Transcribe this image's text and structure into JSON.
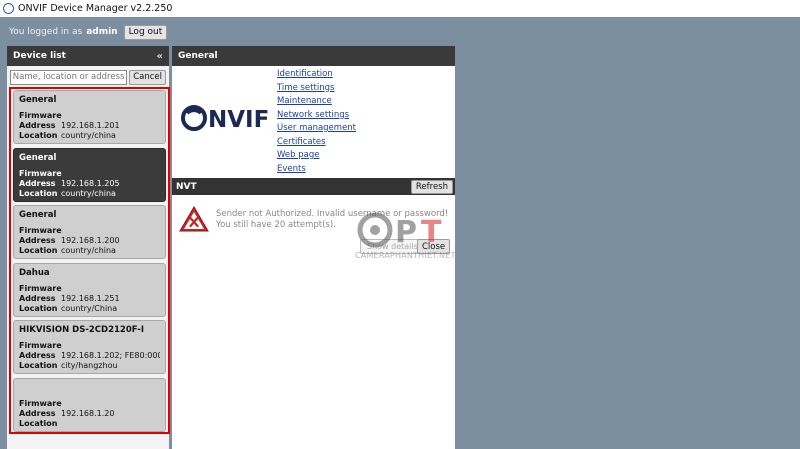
{
  "window": {
    "title": "ONVIF Device Manager v2.2.250"
  },
  "login": {
    "prefix": "You logged in as",
    "user": "admin",
    "logout_label": "Log out"
  },
  "device_list": {
    "title": "Device list",
    "search_placeholder": "Name, location or address",
    "cancel_label": "Cancel",
    "labels": {
      "firmware": "Firmware",
      "address": "Address",
      "location": "Location"
    },
    "devices": [
      {
        "name": "General",
        "address": "192.168.1.201",
        "location": "country/china"
      },
      {
        "name": "General",
        "address": "192.168.1.205",
        "location": "country/china"
      },
      {
        "name": "General",
        "address": "192.168.1.200",
        "location": "country/china"
      },
      {
        "name": "Dahua",
        "address": "192.168.1.251",
        "location": "country/China"
      },
      {
        "name": "HIKVISION DS-2CD2120F-I",
        "address": "192.168.1.202; FE80:0000:0000",
        "location": "city/hangzhou"
      },
      {
        "name": "",
        "address": "192.168.1.20",
        "location": ""
      }
    ]
  },
  "main": {
    "header": "General",
    "logo_text": "ONVIF",
    "links": [
      "Identification",
      "Time settings",
      "Maintenance",
      "Network settings",
      "User management",
      "Certificates",
      "Web page",
      "Events"
    ],
    "nvt_label": "NVT",
    "refresh_label": "Refresh",
    "alert_message": "Sender not Authorized. Invalid username or password! You still have 20 attempt(s).",
    "details_label": "Show details",
    "close_label": "Close"
  },
  "watermark": {
    "text": "CAMERAPHANTHIET.NET",
    "logo_letters": "OPT"
  }
}
